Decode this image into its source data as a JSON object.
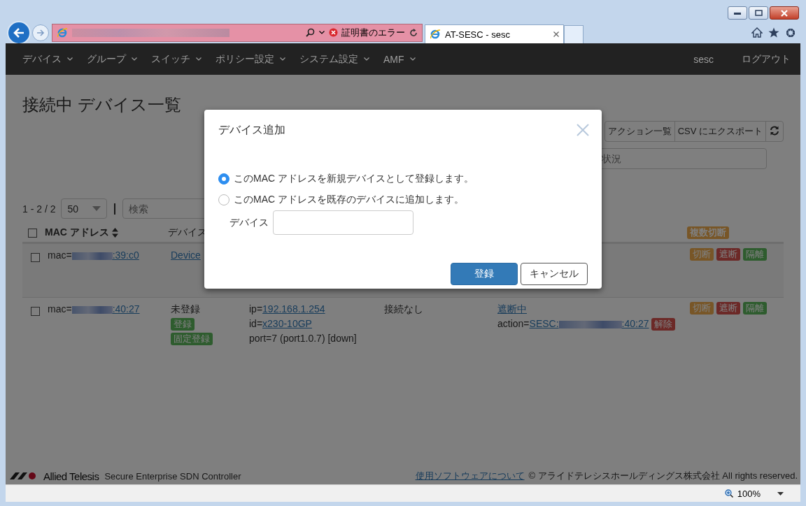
{
  "browser": {
    "cert_error": "証明書のエラー",
    "tab_title": "AT-SESC - sesc",
    "zoom": "100%"
  },
  "nav": {
    "items": [
      "デバイス",
      "グループ",
      "スイッチ",
      "ポリシー設定",
      "システム設定",
      "AMF"
    ],
    "user": "sesc",
    "logout": "ログアウト"
  },
  "page": {
    "title": "接続中 デバイス一覧",
    "toolbar": [
      "アクション一覧",
      "CSV にエクスポート"
    ],
    "status_filter": {
      "placeholder": "状況"
    },
    "range": "1 - 2 / 2",
    "page_size": "50",
    "search": {
      "placeholder": "検索"
    }
  },
  "table": {
    "header_checked": false,
    "columns": [
      "MAC アドレス",
      "デバイス"
    ],
    "bulk_action": "複数切断",
    "rows": [
      {
        "checked": false,
        "mac_label": "mac=",
        "mac": ":39:c0",
        "device": "Device",
        "actions": [
          {
            "label": "切断",
            "kind": "disconnect"
          },
          {
            "label": "遮断",
            "kind": "block"
          },
          {
            "label": "隔離",
            "kind": "isolate"
          }
        ]
      },
      {
        "checked": false,
        "mac_label": "mac=",
        "mac": ":40:27",
        "device_status": "未登録",
        "device_buttons": [
          "登録",
          "固定登録"
        ],
        "ip_label": "ip=",
        "ip": "192.168.1.254",
        "id_label": "id=",
        "id": "x230-10GP",
        "port": "port=7 (port1.0.7) [down]",
        "connection": "接続なし",
        "block_status": "遮断中",
        "action_label": "action=",
        "action_start": "SESC:",
        "action_end": ":40:27",
        "release": "解除",
        "actions": [
          {
            "label": "切断",
            "kind": "disconnect"
          },
          {
            "label": "遮断",
            "kind": "block"
          },
          {
            "label": "隔離",
            "kind": "isolate"
          }
        ]
      }
    ]
  },
  "modal": {
    "title": "デバイス追加",
    "options": [
      {
        "label": "このMAC アドレスを新規デバイスとして登録します。",
        "selected": true
      },
      {
        "label": "このMAC アドレスを既存のデバイスに追加します。",
        "selected": false
      }
    ],
    "device_label": "デバイス",
    "buttons": [
      "登録",
      "キャンセル"
    ]
  },
  "footer": {
    "brand": "Allied Telesis",
    "product": "Secure Enterprise SDN Controller",
    "link": "使用ソフトウェアについて",
    "copyright": "© アライドテレシスホールディングス株式会社 All rights reserved."
  }
}
